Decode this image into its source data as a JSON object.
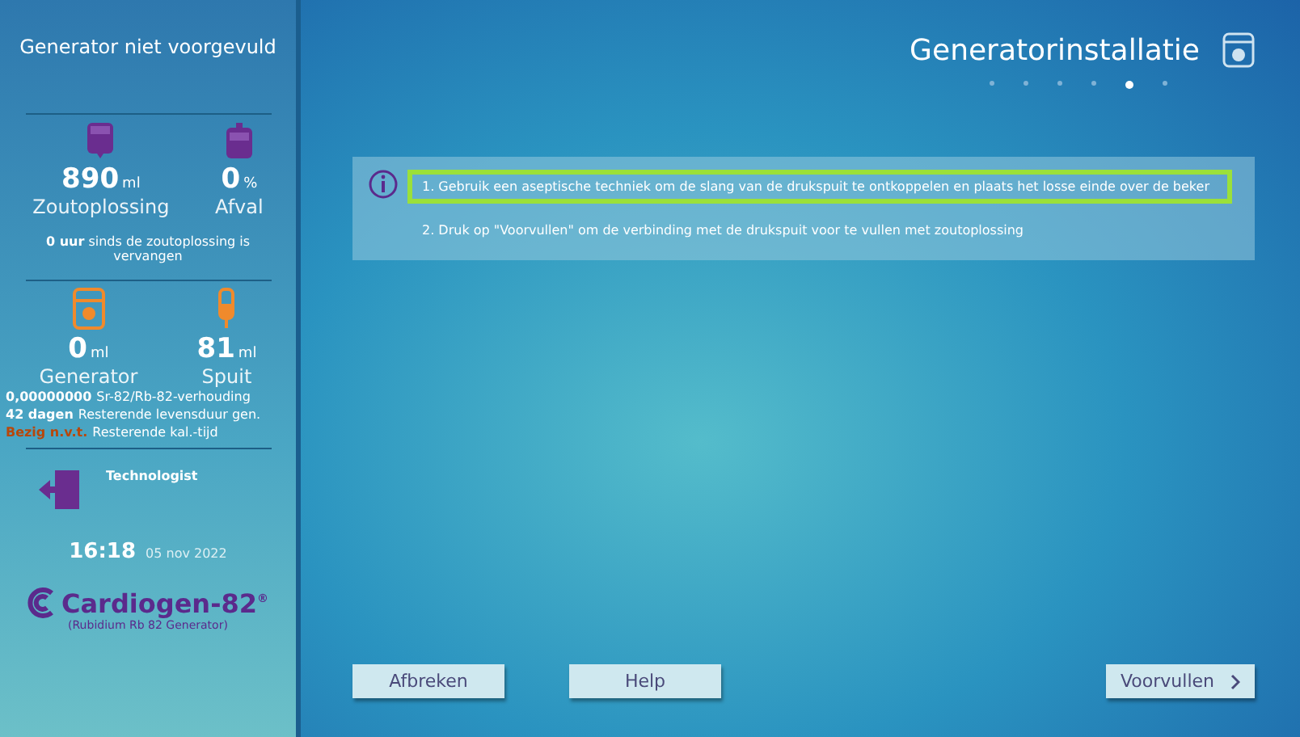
{
  "sidebar": {
    "status": "Generator niet voorgevuld",
    "bags": [
      {
        "value": "890",
        "unit": "ml",
        "label": "Zoutoplossing",
        "kind": "saline"
      },
      {
        "value": "0",
        "unit": "%",
        "label": "Afval",
        "kind": "waste"
      }
    ],
    "saline_note": {
      "value": "0 uur",
      "text": "sinds de zoutoplossing is vervangen"
    },
    "devices": [
      {
        "value": "0",
        "unit": "ml",
        "label": "Generator",
        "kind": "generator"
      },
      {
        "value": "81",
        "unit": "ml",
        "label": "Spuit",
        "kind": "syringe"
      }
    ],
    "stats": [
      {
        "value": "0,00000000",
        "text": "Sr-82/Rb-82-verhouding",
        "color": "#ffffff"
      },
      {
        "value": "42 dagen",
        "text": "Resterende levensduur gen.",
        "color": "#ffffff"
      },
      {
        "value": "Bezig n.v.t.",
        "text": "Resterende kal.-tijd",
        "color": "#b8470a"
      }
    ],
    "user": "Technologist",
    "time": "16:18",
    "date": "05 nov 2022",
    "logo": {
      "name": "Cardiogen-82",
      "sup": "®",
      "subtitle": "(Rubidium Rb 82 Generator)"
    }
  },
  "header": {
    "title": "Generatorinstallatie",
    "steps": [
      {
        "selected": false
      },
      {
        "selected": false
      },
      {
        "selected": false
      },
      {
        "selected": false
      },
      {
        "selected": true
      },
      {
        "selected": false
      }
    ]
  },
  "instructions": [
    {
      "text": "1. Gebruik een aseptische techniek om de slang van de drukspuit te ontkoppelen en plaats het losse einde over de beker",
      "selected": true
    },
    {
      "text": "2. Druk op \"Voorvullen\" om de verbinding met de drukspuit voor te vullen met zoutoplossing",
      "selected": false
    }
  ],
  "buttons": [
    {
      "label": "Afbreken",
      "kind": "plain"
    },
    {
      "label": "Help",
      "kind": "plain"
    },
    {
      "label": "Voorvullen",
      "kind": "next"
    }
  ]
}
